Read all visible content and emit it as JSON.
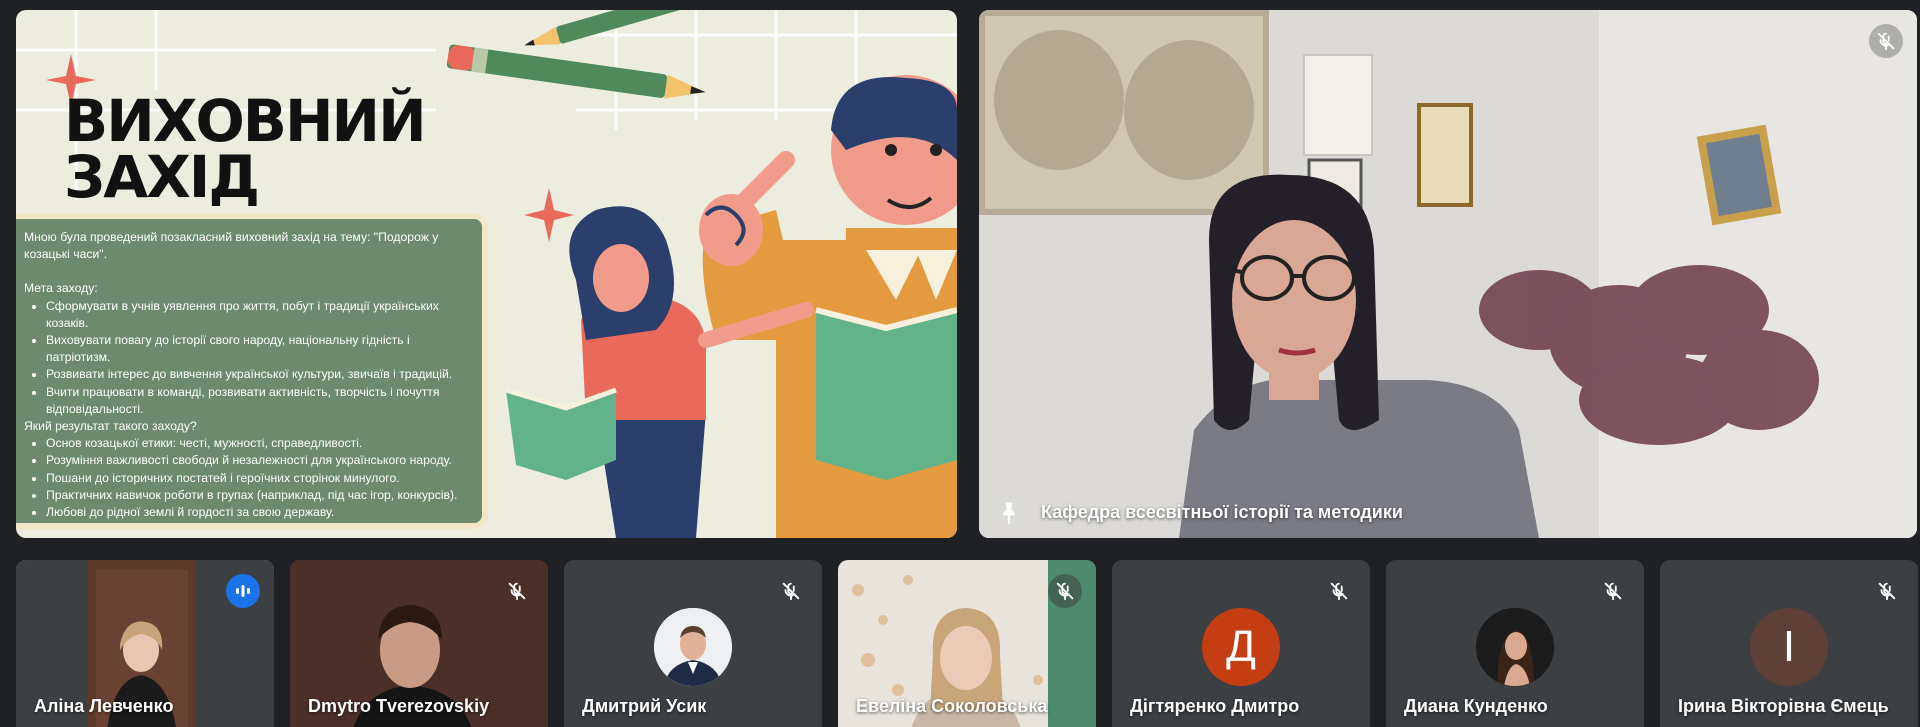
{
  "presentation": {
    "title_line1": "ВИХОВНИЙ",
    "title_line2": "ЗАХІД",
    "intro": "Мною була проведений позакласний виховний захід на тему: \"Подорож у козацькі часи\".",
    "goal_heading": "Мета заходу:",
    "goals": [
      "Сформувати в учнів уявлення про життя, побут і традиції українських козаків.",
      "Виховувати повагу до історії свого народу, національну гідність і патріотизм.",
      "Розвивати інтерес до вивчення української культури, звичаїв і традицій.",
      "Вчити працювати в команді, розвивати активність, творчість і почуття відповідальності."
    ],
    "result_heading": "Який результат такого заходу?",
    "results": [
      "Основ козацької етики: честі, мужності, справедливості.",
      "Розуміння важливості свободи й незалежності для українського народу.",
      "Пошани до історичних постатей і героїчних сторінок минулого.",
      "Практичних навичок роботи в групах (наприклад, під час ігор, конкурсів).",
      "Любові до рідної землі й гордості за свою державу."
    ]
  },
  "camera": {
    "name": "Кафедра всесвітньої історії та методики"
  },
  "participants": [
    {
      "name": "Аліна Левченко",
      "avatar_letter": "",
      "avatar_color": "",
      "mic": "speaking"
    },
    {
      "name": "Dmytro Tverezovskiy",
      "avatar_letter": "",
      "avatar_color": "",
      "mic": "off"
    },
    {
      "name": "Дмитрий Усик",
      "avatar_letter": "",
      "avatar_color": "",
      "mic": "off"
    },
    {
      "name": "Евеліна Соколовська",
      "avatar_letter": "",
      "avatar_color": "",
      "mic": "off"
    },
    {
      "name": "Дігтяренко Дмитро",
      "avatar_letter": "Д",
      "avatar_color": "#c53d13",
      "mic": "off"
    },
    {
      "name": "Диана Кунденко",
      "avatar_letter": "",
      "avatar_color": "",
      "mic": "off"
    },
    {
      "name": "Ірина Вікторівна Ємець",
      "avatar_letter": "І",
      "avatar_color": "#5d4037",
      "mic": "off"
    }
  ],
  "colors": {
    "background": "#202124",
    "tile": "#3c4043",
    "active_outline": "#8ab4f8",
    "speaking": "#1a73e8"
  }
}
